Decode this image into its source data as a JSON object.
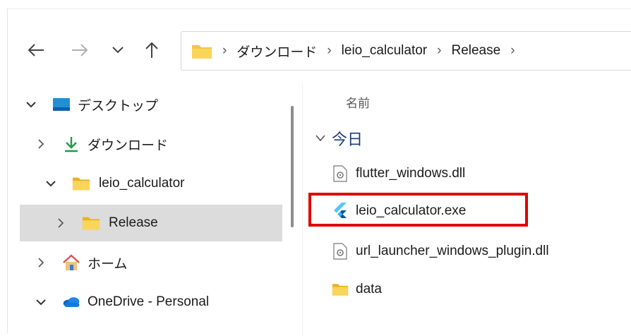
{
  "colors": {
    "highlight": "#e00000",
    "folder": "#f4c542",
    "group_label": "#1b3a78",
    "selected_row": "#dcdcdc"
  },
  "toolbar": {
    "back_icon": "arrow-left-icon",
    "forward_icon": "arrow-right-icon",
    "recent_icon": "chevron-down-icon",
    "up_icon": "arrow-up-icon"
  },
  "address_bar": {
    "segments": [
      "ダウンロード",
      "leio_calculator",
      "Release"
    ]
  },
  "nav_tree": {
    "items": [
      {
        "label": "デスクトップ",
        "icon": "desktop-icon",
        "expanded": true
      },
      {
        "label": "ダウンロード",
        "icon": "download-icon",
        "expanded": false
      },
      {
        "label": "leio_calculator",
        "icon": "folder-icon",
        "expanded": true
      },
      {
        "label": "Release",
        "icon": "folder-icon",
        "expanded": false,
        "selected": true
      },
      {
        "label": "ホーム",
        "icon": "home-icon",
        "expanded": false
      },
      {
        "label": "OneDrive - Personal",
        "icon": "onedrive-icon",
        "expanded": true
      }
    ]
  },
  "file_list": {
    "column_name": "名前",
    "group": "今日",
    "files": [
      {
        "name": "flutter_windows.dll",
        "icon": "dll-file-icon"
      },
      {
        "name": "leio_calculator.exe",
        "icon": "flutter-app-icon",
        "highlighted": true
      },
      {
        "name": "url_launcher_windows_plugin.dll",
        "icon": "dll-file-icon"
      },
      {
        "name": "data",
        "icon": "folder-icon"
      }
    ]
  }
}
